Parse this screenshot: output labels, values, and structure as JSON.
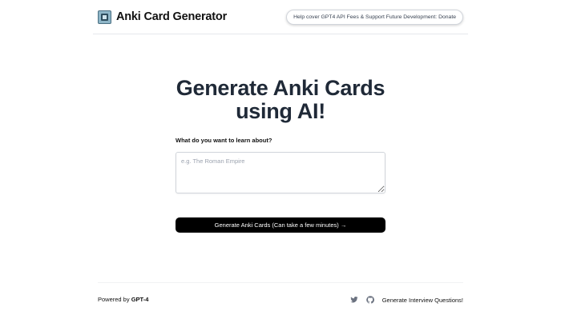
{
  "header": {
    "logo_icon": "anki-logo-icon",
    "brand_name": "Anki Card Generator",
    "donate_label": "Help cover GPT4 API Fees & Support Future Development: Donate"
  },
  "hero": {
    "title_line1": "Generate Anki Cards",
    "title_line2": "using AI!"
  },
  "form": {
    "prompt_label": "What do you want to learn about?",
    "input_value": "",
    "input_placeholder": "e.g. The Roman Empire",
    "generate_label": "Generate Anki Cards (Can take a few minutes) →"
  },
  "footer": {
    "powered_prefix": "Powered by",
    "powered_brand": "GPT-4",
    "twitter_icon": "twitter-icon",
    "github_icon": "github-icon",
    "link_label": "Generate Interview Questions!"
  },
  "colors": {
    "button_bg": "#000000",
    "title_text": "#1f2937",
    "border": "#d1d5db"
  }
}
